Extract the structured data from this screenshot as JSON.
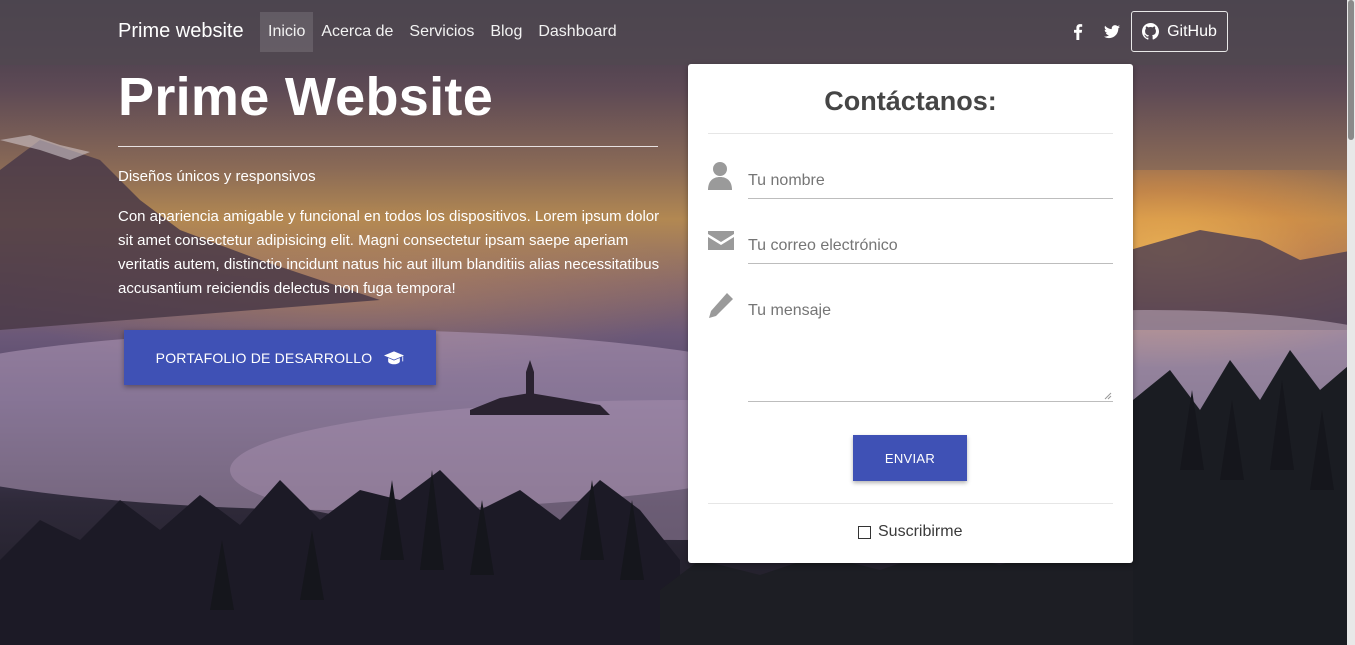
{
  "navbar": {
    "brand": "Prime website",
    "links": [
      {
        "label": "Inicio",
        "active": true
      },
      {
        "label": "Acerca de",
        "active": false
      },
      {
        "label": "Servicios",
        "active": false
      },
      {
        "label": "Blog",
        "active": false
      },
      {
        "label": "Dashboard",
        "active": false
      }
    ],
    "social_icons": [
      "facebook-icon",
      "twitter-icon"
    ],
    "github_label": "GitHub"
  },
  "hero": {
    "title": "Prime Website",
    "subtitle": "Diseños únicos y responsivos",
    "text": "Con apariencia amigable y funcional en todos los dispositivos. Lorem ipsum dolor sit amet consectetur adipisicing elit. Magni consectetur ipsam saepe aperiam veritatis autem, distinctio incidunt natus hic aut illum blanditiis alias necessitatibus accusantium reiciendis delectus non fuga tempora!",
    "cta_label": "PORTAFOLIO DE DESARROLLO",
    "cta_icon": "graduation-cap-icon"
  },
  "contact": {
    "title": "Contáctanos:",
    "name_placeholder": "Tu nombre",
    "email_placeholder": "Tu correo electrónico",
    "message_placeholder": "Tu mensaje",
    "submit_label": "ENVIAR",
    "subscribe_label": "Suscribirme",
    "subscribe_checked": false
  },
  "colors": {
    "primary": "#3f51b5",
    "navbar": "#504850",
    "card": "#ffffff"
  }
}
